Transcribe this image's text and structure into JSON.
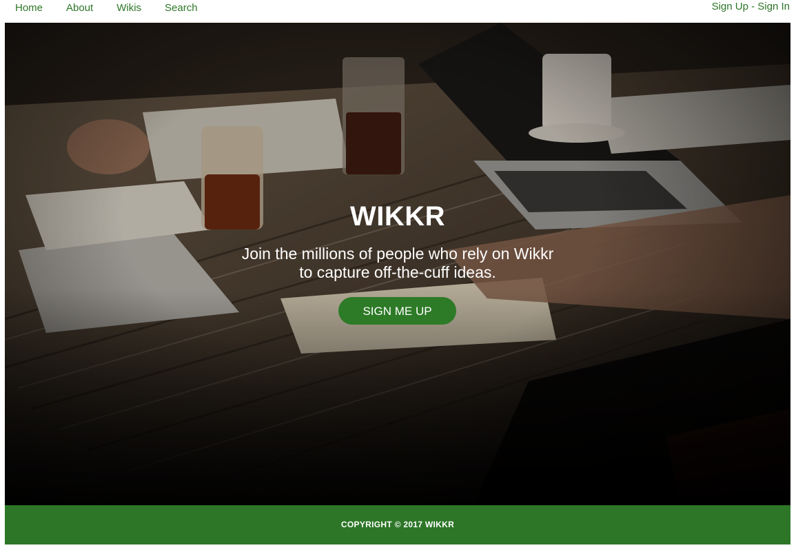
{
  "nav": {
    "links": [
      "Home",
      "About",
      "Wikis",
      "Search"
    ],
    "sign_up": "Sign Up",
    "separator": " - ",
    "sign_in": "Sign In",
    "link_color": "#2d7627"
  },
  "hero": {
    "title": "WIKKR",
    "subtitle_line1": "Join the millions of people who rely on Wikkr",
    "subtitle_line2": "to capture off-the-cuff ideas.",
    "cta_label": "SIGN ME UP",
    "cta_color": "#2d7a27"
  },
  "footer": {
    "text": "COPYRIGHT © 2017 WIKKR",
    "background": "#2d7627"
  }
}
